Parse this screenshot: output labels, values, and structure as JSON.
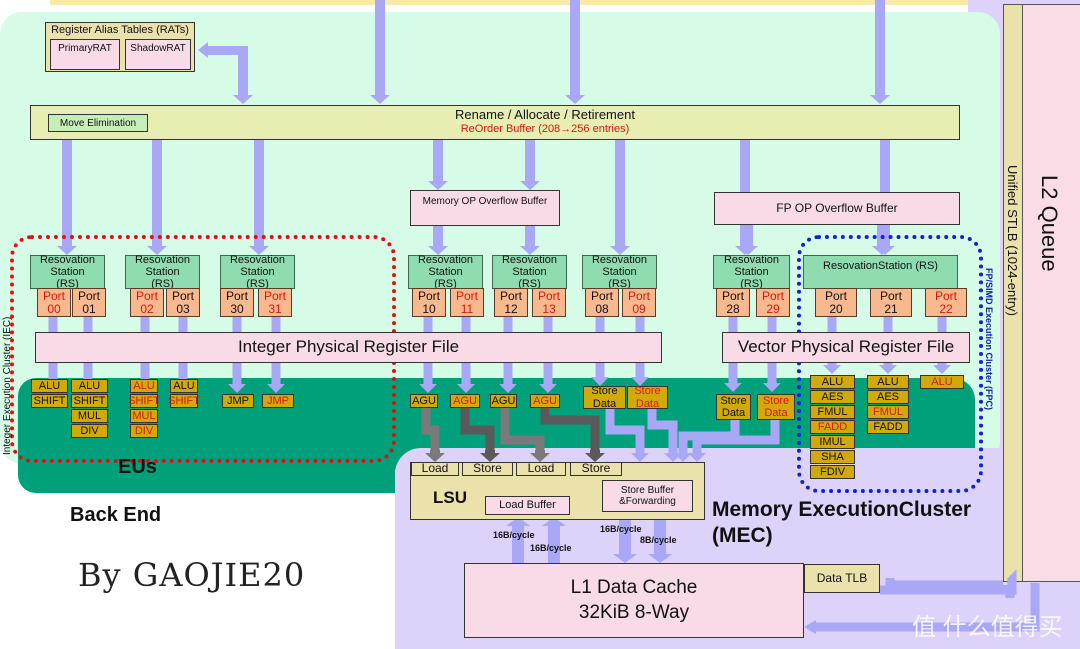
{
  "colors": {
    "backend": "#d6fbe6",
    "eu_band": "#00a07a",
    "mec": "#ddd2fa",
    "arrow": "#a8a8f6",
    "agu_arrow": "#777777",
    "accent_red": "#d8180c",
    "fpc_dots": "#1020d8",
    "iec_dots": "#e01010"
  },
  "rat": {
    "title": "Register Alias Tables (RATs)",
    "primary": "PrimaryRAT",
    "shadow": "ShadowRAT"
  },
  "rename": {
    "title": "Rename / Allocate / Retirement",
    "rob": "ReOrder Buffer  (208→256 entries)",
    "move_elim": "Move Elimination"
  },
  "mem_overflow": "Memory OP Overflow Buffer",
  "fp_overflow": "FP OP Overflow Buffer",
  "rs_label": "Resovation Station (RS)",
  "rs_wide_label": "ResovationStation (RS)",
  "ports": [
    [
      "Port",
      "00"
    ],
    [
      "Port",
      "01"
    ],
    [
      "Port",
      "02"
    ],
    [
      "Port",
      "03"
    ],
    [
      "Port",
      "30"
    ],
    [
      "Port",
      "31"
    ],
    [
      "Port",
      "10"
    ],
    [
      "Port",
      "11"
    ],
    [
      "Port",
      "12"
    ],
    [
      "Port",
      "13"
    ],
    [
      "Port",
      "08"
    ],
    [
      "Port",
      "09"
    ],
    [
      "Port",
      "28"
    ],
    [
      "Port",
      "29"
    ],
    [
      "Port",
      "20"
    ],
    [
      "Port",
      "21"
    ],
    [
      "Port",
      "22"
    ]
  ],
  "int_prf": "Integer Physical Register File",
  "vec_prf": "Vector Physical Register File",
  "eus": {
    "p00": [
      "ALU",
      "SHIFT"
    ],
    "p01": [
      "ALU",
      "SHIFT",
      "MUL",
      "DIV"
    ],
    "p02": [
      "ALU",
      "SHIFT",
      "MUL",
      "DIV"
    ],
    "p03": [
      "ALU",
      "SHIFT"
    ],
    "jmp": "JMP",
    "agu": "AGU",
    "store_data": "Store Data",
    "p20": [
      "ALU",
      "AES",
      "FMUL",
      "FADD",
      "IMUL",
      "SHA",
      "FDIV"
    ],
    "p21": [
      "ALU",
      "AES",
      "FMUL",
      "FADD"
    ],
    "p22": [
      "ALU"
    ]
  },
  "eus_label": "EUs",
  "iec_label": "Integer Execution Cluster (IEC)",
  "fpc_label": "FP/SIMD Execution Cluster (FPC)",
  "lsu": {
    "title": "LSU",
    "load": "Load",
    "store": "Store",
    "load_buffer": "Load Buffer",
    "store_buffer": "Store Buffer &Forwarding"
  },
  "bandwidth": {
    "load1": "16B/cycle",
    "load2": "16B/cycle",
    "store1": "16B/cycle",
    "store2": "8B/cycle"
  },
  "l1": {
    "title": "L1 Data Cache",
    "size": "32KiB 8-Way"
  },
  "dtlb": "Data TLB",
  "mec_label": "Memory ExecutionCluster (MEC)",
  "stlb": "Unified STLB (1024-entry)",
  "l2q": "L2 Queue",
  "back_end": "Back End",
  "author": "By GAOJIE20",
  "watermark": "值 什么值得买"
}
